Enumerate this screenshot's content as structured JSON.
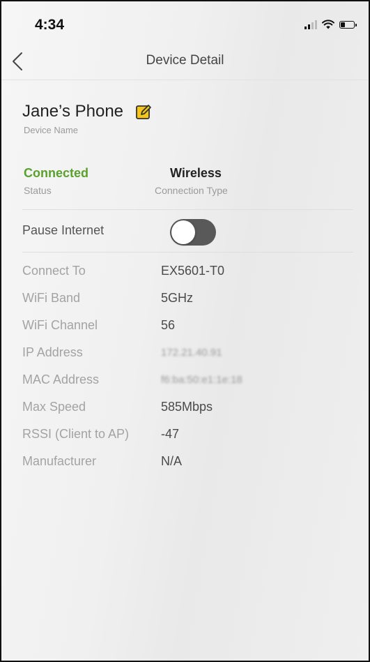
{
  "status_bar": {
    "time": "4:34",
    "icons": [
      "signal-icon",
      "wifi-icon",
      "battery-icon"
    ],
    "battery_level": 0.35
  },
  "nav": {
    "back_icon": "chevron-left-icon",
    "title": "Device Detail"
  },
  "device": {
    "name": "Jane’s Phone",
    "name_label": "Device Name",
    "edit_icon": "edit-icon",
    "edit_icon_color": "#f5c518"
  },
  "status": {
    "value": "Connected",
    "label": "Status",
    "color": "#5aa02c"
  },
  "connection_type": {
    "value": "Wireless",
    "label": "Connection Type"
  },
  "pause_internet": {
    "label": "Pause Internet",
    "enabled": false
  },
  "details": [
    {
      "label": "Connect To",
      "value": "EX5601-T0"
    },
    {
      "label": "WiFi Band",
      "value": "5GHz"
    },
    {
      "label": "WiFi Channel",
      "value": "56"
    },
    {
      "label": "IP Address",
      "value": "172.21.40.91"
    },
    {
      "label": "MAC Address",
      "value": "f6:ba:50:e1:1e:18"
    },
    {
      "label": "Max Speed",
      "value": "585Mbps"
    },
    {
      "label": "RSSI (Client to AP)",
      "value": "-47"
    },
    {
      "label": "Manufacturer",
      "value": "N/A"
    }
  ]
}
